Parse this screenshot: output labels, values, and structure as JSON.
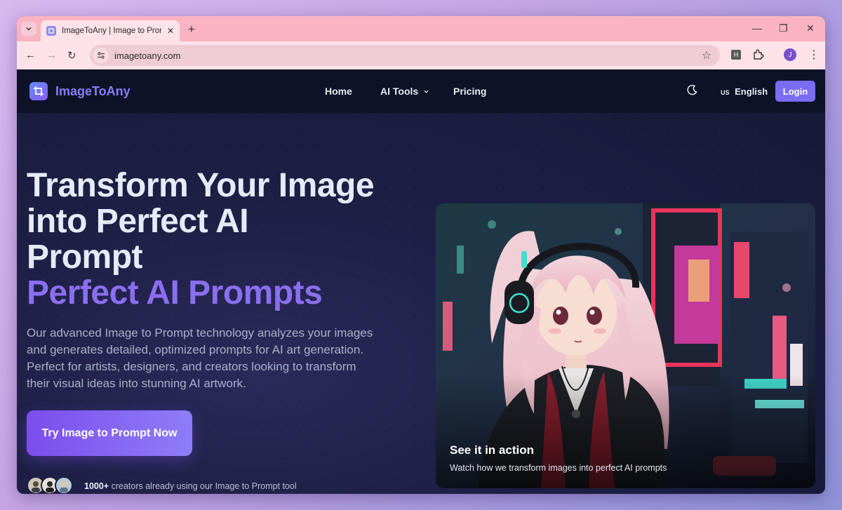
{
  "browser": {
    "tab_title": "ImageToAny | Image to Prompt",
    "url": "imagetoany.com",
    "profile_initial": "J",
    "extension_label": "H"
  },
  "site": {
    "logo_text": "ImageToAny",
    "nav": {
      "home": "Home",
      "ai_tools": "AI Tools",
      "pricing": "Pricing"
    },
    "lang_flag": "US",
    "lang": "English",
    "login": "Login"
  },
  "hero": {
    "title_line1": "Transform Your Image",
    "title_line2": "into Perfect AI",
    "title_line3": "Prompt",
    "title_accent": "Perfect AI Prompts",
    "description": "Our advanced Image to Prompt technology analyzes your images and generates detailed, optimized prompts for AI art generation. Perfect for artists, designers, and creators looking to transform their visual ideas into stunning AI artwork.",
    "cta": "Try Image to Prompt Now",
    "social_count": "1000+",
    "social_text": " creators already using our Image to Prompt tool"
  },
  "showcase": {
    "caption_title": "See it in action",
    "caption_sub": "Watch how we transform images into perfect AI prompts"
  },
  "colors": {
    "accent": "#8b6ff0",
    "tabstrip": "#f9b3c2",
    "toolbar": "#fde2e8",
    "login": "#7c6cf3"
  }
}
